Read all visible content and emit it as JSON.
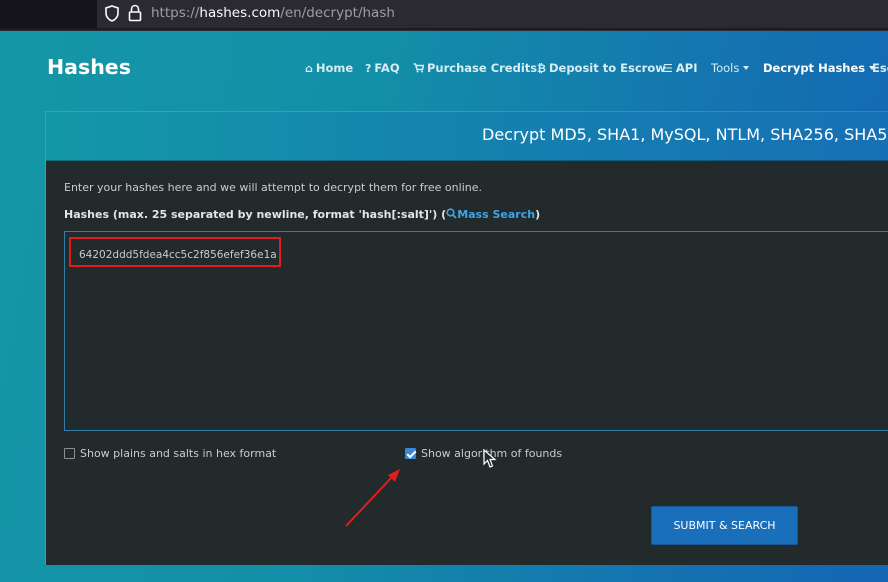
{
  "browser": {
    "url_prefix": "https://",
    "url_host": "hashes.com",
    "url_path": "/en/decrypt/hash"
  },
  "navbar": {
    "brand": "Hashes",
    "items": [
      {
        "label": "Home",
        "icon": "home-icon",
        "glyph": "⌂"
      },
      {
        "label": "FAQ",
        "icon": "question-icon",
        "glyph": "?"
      },
      {
        "label": "Purchase Credits",
        "icon": "cart-icon",
        "glyph": "🛒"
      },
      {
        "label": "Deposit to Escrow",
        "icon": "bitcoin-icon",
        "glyph": "₿"
      },
      {
        "label": "API",
        "icon": "list-icon",
        "glyph": "☰"
      },
      {
        "label": "Tools",
        "dropdown": true
      },
      {
        "label": "Decrypt Hashes",
        "dropdown": true,
        "active": true
      },
      {
        "label": "Esc"
      }
    ]
  },
  "card": {
    "title": "Decrypt MD5, SHA1, MySQL, NTLM, SHA256, SHA5",
    "intro": "Enter your hashes here and we will attempt to decrypt them for free online.",
    "hashes_label": "Hashes (max. 25 separated by newline, format 'hash[:salt]') (",
    "mass_search_link": "Mass Search",
    "hashes_label_end": ")",
    "hash_input_value": "64202ddd5fdea4cc5c2f856efef36e1a",
    "option_hex": {
      "label": "Show plains and salts in hex format",
      "checked": false
    },
    "option_algorithm": {
      "label": "Show algorithm of founds",
      "checked": true
    },
    "submit_label": "SUBMIT & SEARCH"
  },
  "colors": {
    "annotation": "#e01e1e",
    "accent": "#1a6fba",
    "link": "#3fa3e8"
  }
}
